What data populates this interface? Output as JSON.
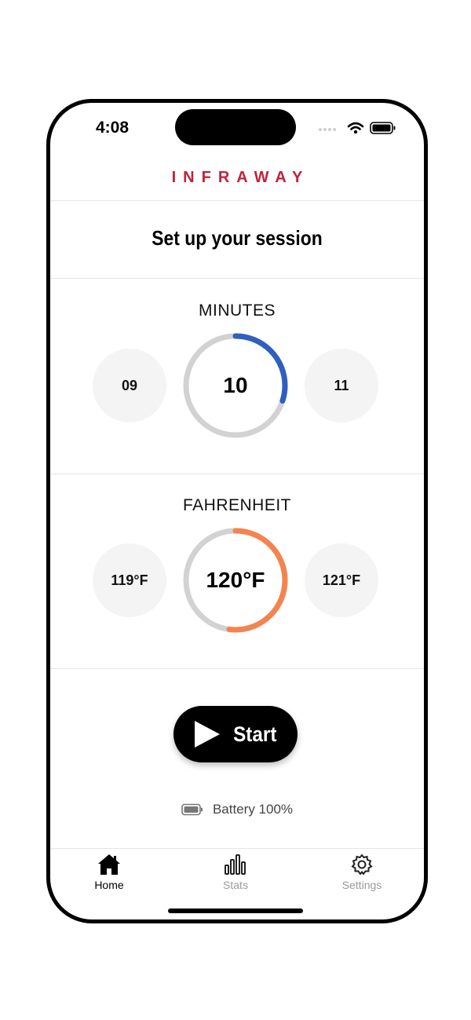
{
  "status_bar": {
    "time": "4:08"
  },
  "header": {
    "brand": "INFRAWAY",
    "title": "Set up your session"
  },
  "minutes": {
    "label": "MINUTES",
    "prev": "09",
    "current": "10",
    "next": "11",
    "progress": 0.3,
    "color": "#2f5fbf"
  },
  "temperature": {
    "label": "FAHRENHEIT",
    "prev": "119°F",
    "current": "120°F",
    "next": "121°F",
    "progress": 0.52,
    "color": "#f5834f"
  },
  "actions": {
    "start_label": "Start"
  },
  "device": {
    "battery_text": "Battery 100%"
  },
  "tabs": [
    {
      "label": "Home",
      "icon": "home-icon",
      "active": true
    },
    {
      "label": "Stats",
      "icon": "stats-icon",
      "active": false
    },
    {
      "label": "Settings",
      "icon": "gear-icon",
      "active": false
    }
  ]
}
